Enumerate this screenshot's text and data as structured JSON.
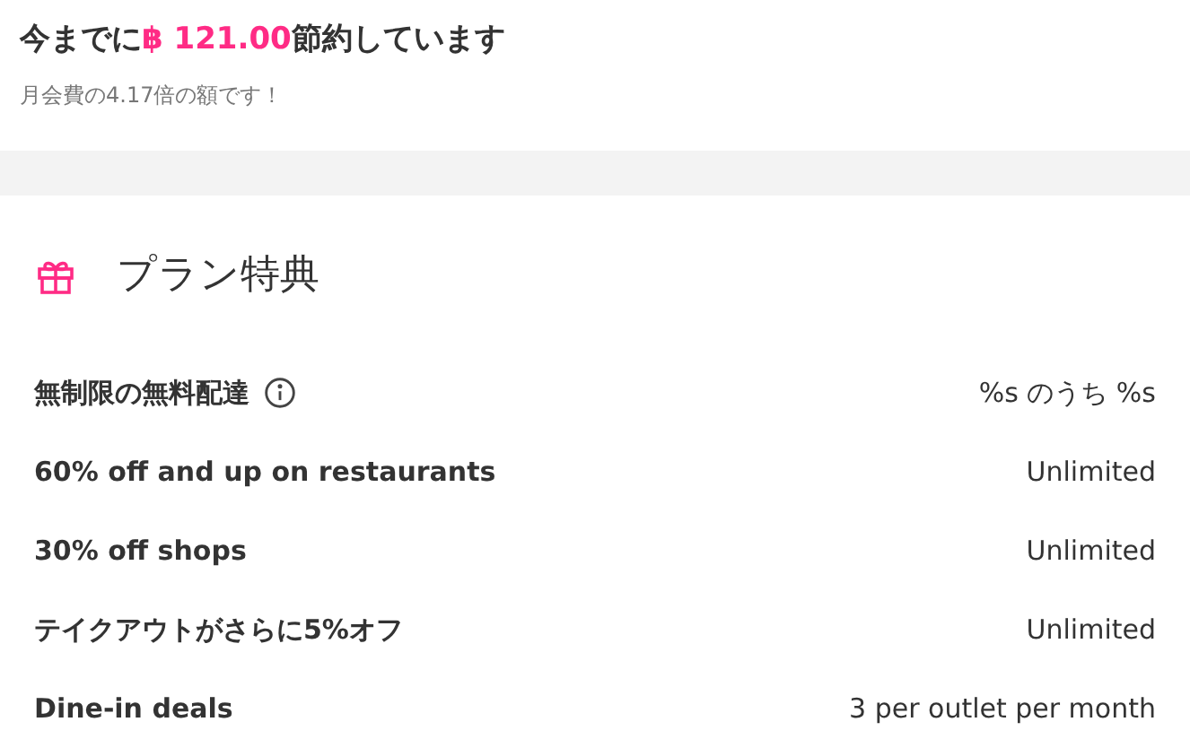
{
  "savings": {
    "prefix": "今までに",
    "amount": "฿ 121.00",
    "suffix": "節約しています",
    "subtitle": "月会費の4.17倍の額です！"
  },
  "benefits": {
    "title": "プラン特典",
    "items": [
      {
        "label": "無制限の無料配達",
        "info": true,
        "value": "%s のうち %s"
      },
      {
        "label": "60% off and up on restaurants",
        "info": false,
        "value": "Unlimited"
      },
      {
        "label": "30% off shops",
        "info": false,
        "value": "Unlimited"
      },
      {
        "label": "テイクアウトがさらに5%オフ",
        "info": false,
        "value": "Unlimited"
      },
      {
        "label": "Dine-in deals",
        "info": false,
        "value": "3 per outlet per month"
      }
    ]
  }
}
